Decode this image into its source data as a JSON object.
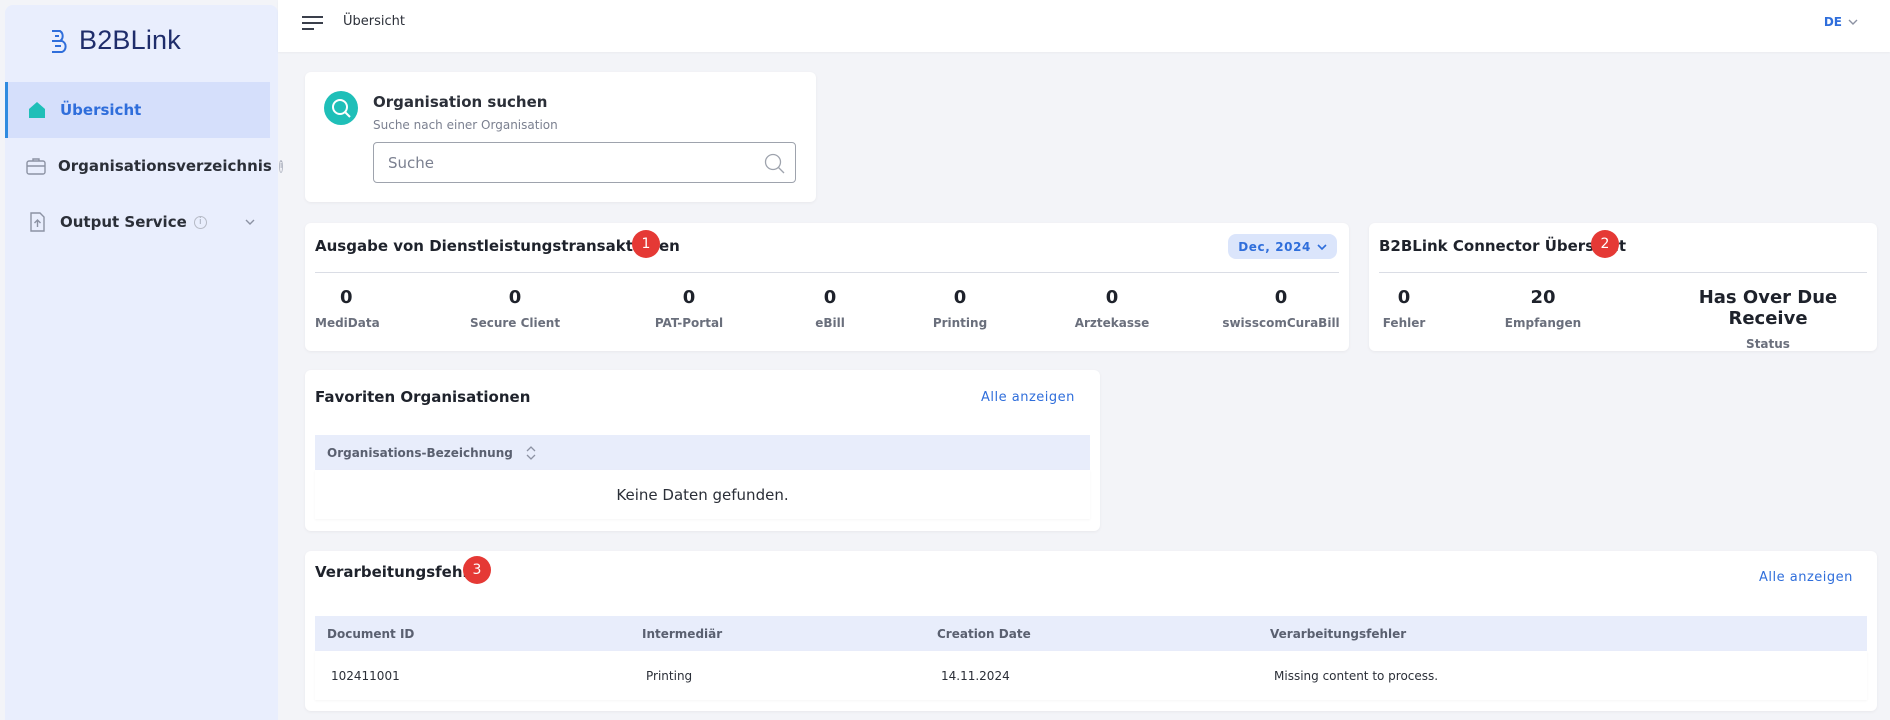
{
  "app": {
    "name": "B2BLink"
  },
  "sidebar": {
    "items": [
      {
        "label": "Übersicht",
        "icon": "home-icon",
        "active": true
      },
      {
        "label": "Organisationsverzeichnis",
        "icon": "briefcase-icon",
        "info": "i"
      },
      {
        "label": "Output Service",
        "icon": "upload-file-icon",
        "info": "i",
        "expandable": true
      }
    ]
  },
  "topbar": {
    "breadcrumb": "Übersicht",
    "language": "DE"
  },
  "search": {
    "title": "Organisation suchen",
    "subtitle": "Suche nach einer Organisation",
    "placeholder": "Suche"
  },
  "transactions": {
    "title": "Ausgabe von Dienstleistungstransaktionen",
    "badge": "1",
    "period": "Dec, 2024",
    "stats": [
      {
        "label": "MediData",
        "value": "0"
      },
      {
        "label": "Secure Client",
        "value": "0"
      },
      {
        "label": "PAT-Portal",
        "value": "0"
      },
      {
        "label": "eBill",
        "value": "0"
      },
      {
        "label": "Printing",
        "value": "0"
      },
      {
        "label": "Arztekasse",
        "value": "0"
      },
      {
        "label": "swisscomCuraBill",
        "value": "0"
      }
    ]
  },
  "connector": {
    "title": "B2BLink Connector Übersicht",
    "badge": "2",
    "stats": [
      {
        "label": "Fehler",
        "value": "0"
      },
      {
        "label": "Empfangen",
        "value": "20"
      },
      {
        "label": "Status",
        "value": "Has Over Due Receive"
      }
    ]
  },
  "favorites": {
    "title": "Favoriten Organisationen",
    "show_all": "Alle anzeigen",
    "column": "Organisations-Bezeichnung",
    "empty": "Keine Daten gefunden."
  },
  "errors": {
    "title": "Verarbeitungsfehler",
    "badge": "3",
    "show_all": "Alle anzeigen",
    "columns": [
      "Document ID",
      "Intermediär",
      "Creation Date",
      "Verarbeitungsfehler"
    ],
    "rows": [
      {
        "doc_id": "102411001",
        "intermediary": "Printing",
        "date": "14.11.2024",
        "error": "Missing content to process."
      }
    ]
  },
  "colors": {
    "accent": "#2f6edb",
    "teal": "#1fbfb8",
    "badge_red": "#e53935",
    "sidebar_bg": "#e9eefd"
  }
}
